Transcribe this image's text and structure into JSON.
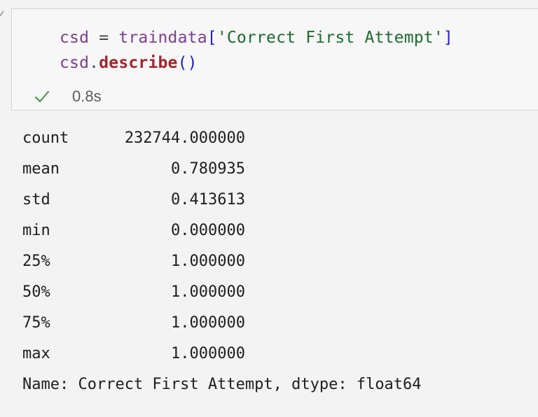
{
  "code": {
    "line1": {
      "var": "csd",
      "eq": " = ",
      "obj": "traindata",
      "open": "[",
      "str": "'Correct First Attempt'",
      "close": "]"
    },
    "line2": {
      "var": "csd",
      "dot": ".",
      "fn": "describe",
      "parens": "()"
    }
  },
  "status": {
    "icon": "check-icon",
    "time": "0.8s",
    "color": "#3f9142"
  },
  "output": {
    "rows": [
      {
        "label": "count",
        "value": "232744.000000"
      },
      {
        "label": "mean",
        "value": "0.780935"
      },
      {
        "label": "std",
        "value": "0.413613"
      },
      {
        "label": "min",
        "value": "0.000000"
      },
      {
        "label": "25%",
        "value": "1.000000"
      },
      {
        "label": "50%",
        "value": "1.000000"
      },
      {
        "label": "75%",
        "value": "1.000000"
      },
      {
        "label": "max",
        "value": "1.000000"
      }
    ],
    "footer": "Name: Correct First Attempt, dtype: float64"
  }
}
